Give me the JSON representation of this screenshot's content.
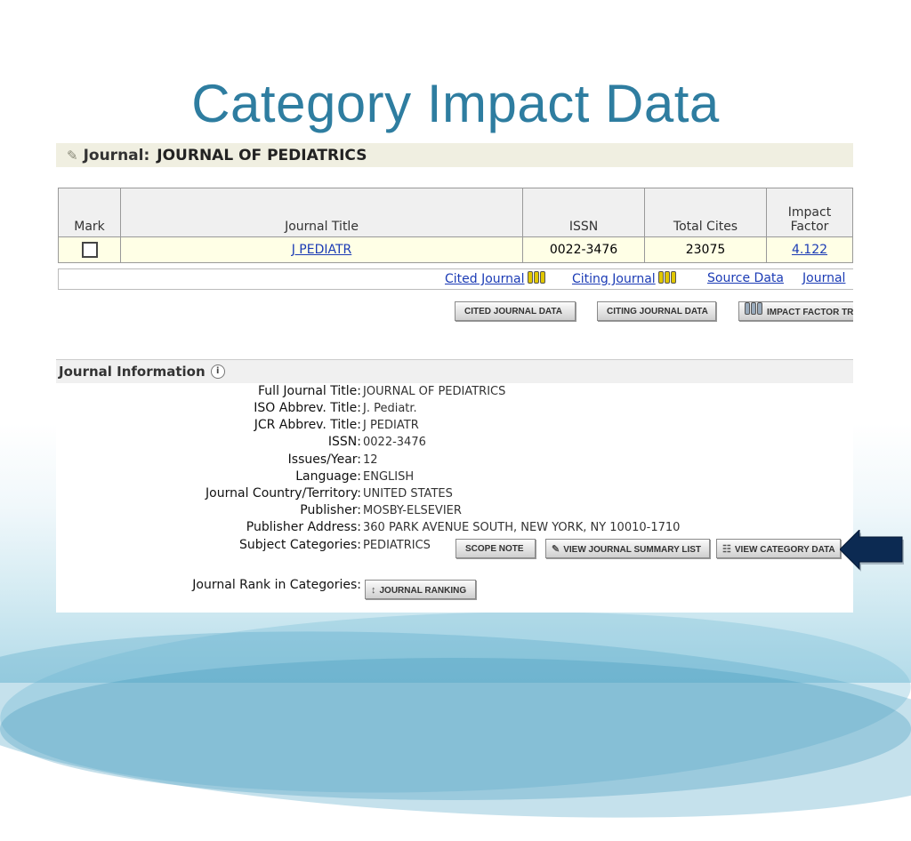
{
  "slide": {
    "title": "Category Impact Data"
  },
  "journal_header": {
    "label": "Journal:",
    "name": "JOURNAL OF PEDIATRICS"
  },
  "table": {
    "headers": [
      "Mark",
      "Journal Title",
      "ISSN",
      "Total Cites",
      "Impact Factor"
    ],
    "row": {
      "title": "J PEDIATR",
      "issn": "0022-3476",
      "total_cites": "23075",
      "impact_factor": "4.122"
    }
  },
  "links": {
    "cited_journal": "Cited Journal",
    "citing_journal": "Citing Journal",
    "source_data": "Source Data",
    "journal": "Journal"
  },
  "buttons": {
    "cited_journal_data": "CITED JOURNAL DATA",
    "citing_journal_data": "CITING JOURNAL DATA",
    "impact_factor_trend": "IMPACT FACTOR TREN",
    "scope_note": "SCOPE NOTE",
    "view_journal_summary_list": "VIEW JOURNAL SUMMARY LIST",
    "view_category_data": "VIEW CATEGORY DATA",
    "journal_ranking": "JOURNAL RANKING"
  },
  "journal_information": {
    "heading": "Journal Information",
    "fields": [
      {
        "label": "Full Journal Title:",
        "value": "JOURNAL OF PEDIATRICS"
      },
      {
        "label": "ISO Abbrev. Title:",
        "value": "J. Pediatr."
      },
      {
        "label": "JCR Abbrev. Title:",
        "value": "J PEDIATR"
      },
      {
        "label": "ISSN:",
        "value": "0022-3476"
      },
      {
        "label": "Issues/Year:",
        "value": "12"
      },
      {
        "label": "Language:",
        "value": "ENGLISH"
      },
      {
        "label": "Journal Country/Territory:",
        "value": "UNITED STATES"
      },
      {
        "label": "Publisher:",
        "value": "MOSBY-ELSEVIER"
      },
      {
        "label": "Publisher Address:",
        "value": "360 PARK AVENUE SOUTH, NEW YORK, NY 10010-1710"
      },
      {
        "label": "Subject Categories:",
        "value": "PEDIATRICS"
      }
    ],
    "rank_label": "Journal Rank in Categories:"
  },
  "colors": {
    "title": "#2e7da0",
    "link": "#1b3bb5",
    "arrow": "#0c2a52"
  }
}
